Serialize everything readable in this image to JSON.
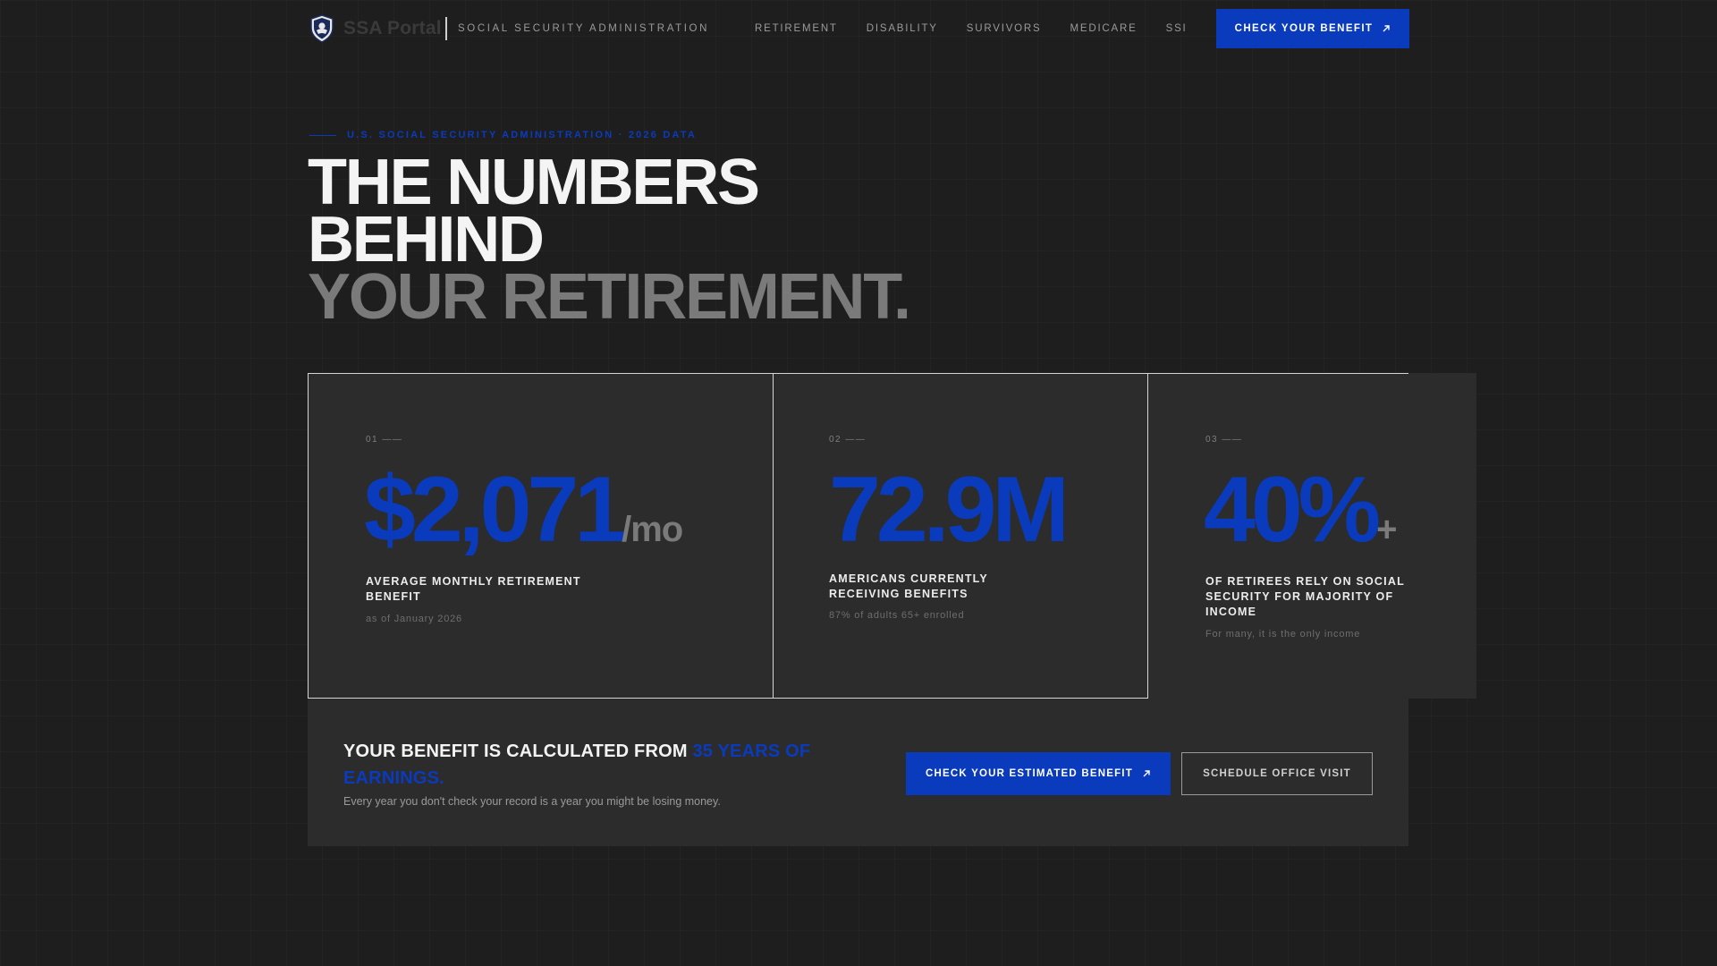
{
  "header": {
    "brand": "SSA Portal",
    "agency": "SOCIAL SECURITY ADMINISTRATION",
    "nav": [
      "RETIREMENT",
      "DISABILITY",
      "SURVIVORS",
      "MEDICARE",
      "SSI"
    ],
    "cta_label": "CHECK YOUR BENEFIT",
    "logo_icon": "shield-eagle-icon"
  },
  "hero": {
    "eyebrow": "U.S. SOCIAL SECURITY ADMINISTRATION · 2026 DATA",
    "title_line1": "THE NUMBERS",
    "title_line2": "BEHIND",
    "title_line3": "YOUR RETIREMENT."
  },
  "stats": [
    {
      "index": "01 ——",
      "value": "$2,071",
      "suffix": "/mo",
      "label_line1": "AVERAGE MONTHLY RETIREMENT",
      "label_line2": "BENEFIT",
      "label_line3": "",
      "sub": "as of January 2026"
    },
    {
      "index": "02 ——",
      "value": "72.9M",
      "suffix": "",
      "label_line1": "AMERICANS CURRENTLY",
      "label_line2": "RECEIVING BENEFITS",
      "label_line3": "",
      "sub": "87% of adults 65+ enrolled"
    },
    {
      "index": "03 ——",
      "value": "40%",
      "suffix": "+",
      "label_line1": "OF RETIREES RELY ON SOCIAL",
      "label_line2": "SECURITY FOR MAJORITY OF",
      "label_line3": "INCOME",
      "sub": "For many, it is the only income"
    }
  ],
  "cta_panel": {
    "headline": "YOUR BENEFIT IS CALCULATED FROM ",
    "headline_highlight": "35 YEARS OF EARNINGS.",
    "sub": "Every year you don't check your record is a year you might be losing money.",
    "primary_label": "CHECK YOUR ESTIMATED BENEFIT",
    "secondary_label": "SCHEDULE OFFICE VISIT"
  },
  "colors": {
    "accent": "#0a3bbd",
    "background": "#1e1e1e",
    "card": "#2c2c2c",
    "muted": "#7a7a7a"
  }
}
